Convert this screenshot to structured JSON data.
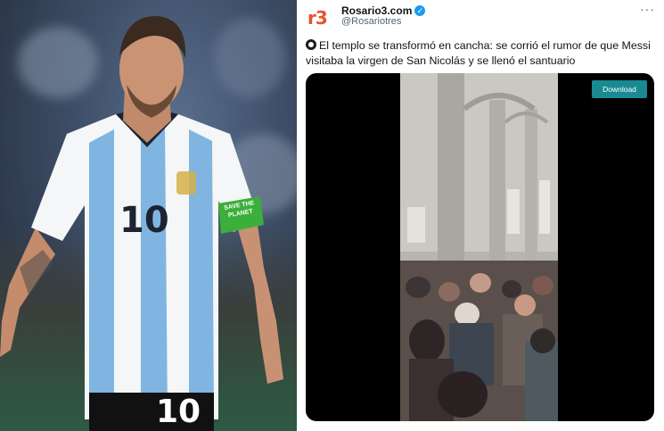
{
  "tweet": {
    "account_name": "Rosario3.com",
    "handle": "@Rosariotres",
    "logo_text": "r3",
    "text": "El templo se transformó en cancha: se corrió el rumor de que Messi visitaba la virgen de San Nicolás y se llenó el santuario",
    "emoji": "soccer-ball-icon",
    "download_label": "Download"
  },
  "photo": {
    "jersey_number": "10",
    "captain_band_text": "SAVE THE PLANET"
  },
  "colors": {
    "brand": "#e8542a",
    "verified": "#1d9bf0",
    "download_button": "#1a8a92",
    "jersey_blue": "#7fb5e0",
    "text": "#0f1419",
    "muted": "#536471"
  }
}
